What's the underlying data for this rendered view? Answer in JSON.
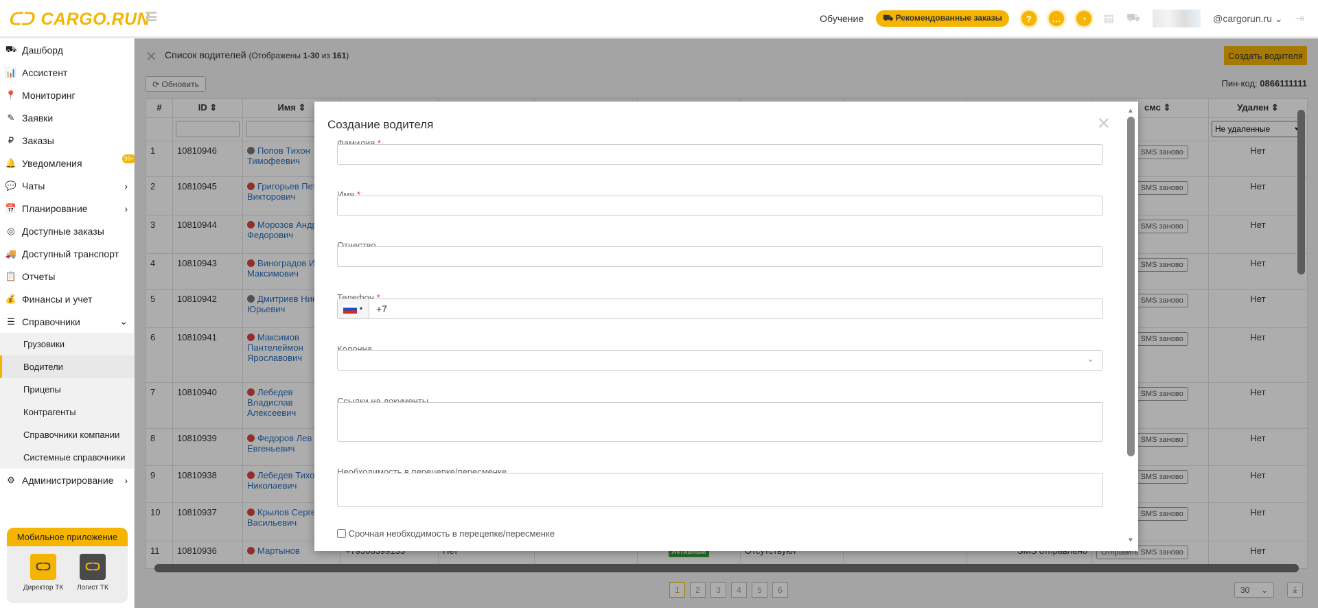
{
  "header": {
    "logo": "CARGO.RUN",
    "training": "Обучение",
    "recommended": "Рекомендованные заказы",
    "user": "@cargorun.ru"
  },
  "sidebar": {
    "items": [
      {
        "label": "Дашборд",
        "icon": "⛟"
      },
      {
        "label": "Ассистент",
        "icon": "📊"
      },
      {
        "label": "Мониторинг",
        "icon": "📍"
      },
      {
        "label": "Заявки",
        "icon": "✎"
      },
      {
        "label": "Заказы",
        "icon": "₽"
      },
      {
        "label": "Уведомления",
        "icon": "🔔",
        "badge": "99+"
      },
      {
        "label": "Чаты",
        "icon": "💬",
        "chevron": "›"
      },
      {
        "label": "Планирование",
        "icon": "📅",
        "chevron": "›"
      },
      {
        "label": "Доступные заказы",
        "icon": "◎"
      },
      {
        "label": "Доступный транспорт",
        "icon": "🚚"
      },
      {
        "label": "Отчеты",
        "icon": "📋"
      },
      {
        "label": "Финансы и учет",
        "icon": "💰"
      },
      {
        "label": "Справочники",
        "icon": "☰",
        "chevron": "⌄"
      }
    ],
    "subitems": [
      "Грузовики",
      "Водители",
      "Прицепы",
      "Контрагенты",
      "Справочники компании",
      "Системные справочники"
    ],
    "admin": {
      "label": "Администрирование",
      "icon": "⚙",
      "chevron": "›"
    },
    "mobile": {
      "title": "Мобильное приложение",
      "apps": [
        "Директор ТК",
        "Логист ТК"
      ]
    }
  },
  "page": {
    "title": "Список водителей",
    "shown_prefix": "(Отображены ",
    "shown_range": "1-30",
    "shown_of": " из ",
    "total": "161",
    "shown_suffix": ")",
    "refresh": "Обновить",
    "create": "Создать водителя",
    "pin_label": "Пин-код:",
    "pin": "0866111111"
  },
  "table": {
    "headers": {
      "num": "#",
      "id": "ID",
      "name": "Имя",
      "sms": "смс",
      "deleted": "Удален"
    },
    "deleted_filter": "Не удаленные",
    "resend": "Отправить SMS заново",
    "rows": [
      {
        "n": "1",
        "id": "10810946",
        "name": "Попов Тихон Тимофеевич",
        "dot": "#777",
        "del": "Нет"
      },
      {
        "n": "2",
        "id": "10810945",
        "name": "Григорьев Петр Викторович",
        "dot": "#d9443f",
        "del": "Нет"
      },
      {
        "n": "3",
        "id": "10810944",
        "name": "Морозов Андрей Федорович",
        "dot": "#d9443f",
        "del": "Нет"
      },
      {
        "n": "4",
        "id": "10810943",
        "name": "Виноградов Иван Максимович",
        "dot": "#d9443f",
        "del": "Нет"
      },
      {
        "n": "5",
        "id": "10810942",
        "name": "Дмитриев Никита Юрьевич",
        "dot": "#777",
        "del": "Нет"
      },
      {
        "n": "6",
        "id": "10810941",
        "name": "Максимов Пантелеймон Ярославович",
        "dot": "#d9443f",
        "del": "Нет"
      },
      {
        "n": "7",
        "id": "10810940",
        "name": "Лебедев Владислав Алексеевич",
        "dot": "#d9443f",
        "del": "Нет"
      },
      {
        "n": "8",
        "id": "10810939",
        "name": "Федоров Лев Евгеньевич",
        "dot": "#d9443f",
        "del": "Нет"
      },
      {
        "n": "9",
        "id": "10810938",
        "name": "Лебедев Тихон Николаевич",
        "dot": "#d9443f",
        "del": "Нет"
      },
      {
        "n": "10",
        "id": "10810937",
        "name": "Крылов Сергей Васильевич",
        "dot": "#d9443f",
        "del": "Нет"
      },
      {
        "n": "11",
        "id": "10810936",
        "name": "Мартынов",
        "dot": "#d9443f",
        "del": "Нет",
        "phone": "+79508399133",
        "col4": "Нет",
        "status": "Активный",
        "docs": "Отсутствуют",
        "pwd": "******",
        "sms": "SMS отправлено"
      }
    ]
  },
  "pagination": {
    "pages": [
      "1",
      "2",
      "3",
      "4",
      "5",
      "6"
    ],
    "per_page": "30"
  },
  "modal": {
    "title": "Создание водителя",
    "fields": [
      {
        "label": "Фамилия",
        "required": "*"
      },
      {
        "label": "Имя",
        "required": "*"
      },
      {
        "label": "Отчество"
      },
      {
        "label": "Телефон",
        "required": "*",
        "value": "+7"
      },
      {
        "label": "Колонна"
      },
      {
        "label": "Ссылки на документы"
      },
      {
        "label": "Необходимость в перецепке/пересменке"
      }
    ],
    "checkbox": "Срочная необходимость в перецепке/пересменке"
  }
}
